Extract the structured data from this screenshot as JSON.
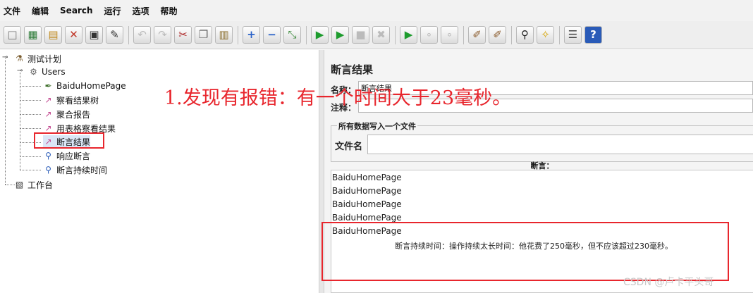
{
  "menu": {
    "items": [
      "文件",
      "编辑",
      "Search",
      "运行",
      "选项",
      "帮助"
    ]
  },
  "toolbar": {
    "buttons": [
      {
        "name": "new-icon",
        "glyph": "□"
      },
      {
        "name": "templates-icon",
        "glyph": "▦"
      },
      {
        "name": "open-icon",
        "glyph": "▤"
      },
      {
        "name": "close-icon",
        "glyph": "✕"
      },
      {
        "name": "save-icon",
        "glyph": "▣"
      },
      {
        "name": "save-as-icon",
        "glyph": "✎"
      },
      {
        "name": "undo-icon",
        "glyph": "↶"
      },
      {
        "name": "redo-icon",
        "glyph": "↷"
      },
      {
        "name": "cut-icon",
        "glyph": "✂"
      },
      {
        "name": "copy-icon",
        "glyph": "❐"
      },
      {
        "name": "paste-icon",
        "glyph": "▥"
      },
      {
        "name": "expand-icon",
        "glyph": "+"
      },
      {
        "name": "collapse-icon",
        "glyph": "−"
      },
      {
        "name": "toggle-icon",
        "glyph": "⤡"
      },
      {
        "name": "start-icon",
        "glyph": "▶"
      },
      {
        "name": "start-no-pause-icon",
        "glyph": "▶"
      },
      {
        "name": "stop-icon",
        "glyph": "■"
      },
      {
        "name": "shutdown-icon",
        "glyph": "✖"
      },
      {
        "name": "remote-start-icon",
        "glyph": "▶"
      },
      {
        "name": "remote-stop-icon",
        "glyph": "∘"
      },
      {
        "name": "remote-shutdown-icon",
        "glyph": "∘"
      },
      {
        "name": "clear-icon",
        "glyph": "✐"
      },
      {
        "name": "clear-all-icon",
        "glyph": "✐"
      },
      {
        "name": "search-icon",
        "glyph": "⚲"
      },
      {
        "name": "reset-search-icon",
        "glyph": "✧"
      },
      {
        "name": "function-helper-icon",
        "glyph": "☰"
      },
      {
        "name": "help-icon",
        "glyph": "?"
      }
    ]
  },
  "tree": {
    "test_plan": "测试计划",
    "users": "Users",
    "children": [
      "BaiduHomePage",
      "察看结果树",
      "聚合报告",
      "用表格察看结果",
      "断言结果",
      "响应断言",
      "断言持续时间"
    ],
    "workbench": "工作台"
  },
  "panel": {
    "title": "断言结果",
    "name_label": "名称：",
    "name_value": "断言结果",
    "comment_label": "注释：",
    "group_title": "所有数据写入一个文件",
    "filename_label": "文件名",
    "assert_header": "断言：",
    "results": [
      "BaiduHomePage",
      "BaiduHomePage",
      "BaiduHomePage",
      "BaiduHomePage",
      "BaiduHomePage"
    ],
    "failure_message": "断言持续时间：操作持续太长时间：他花费了250毫秒，但不应该超过230毫秒。"
  },
  "annotation": {
    "text": "1.发现有报错：有一个时间大于23毫秒。",
    "color": "#e8262d"
  },
  "watermark": "CSDN @卢卡平头哥"
}
